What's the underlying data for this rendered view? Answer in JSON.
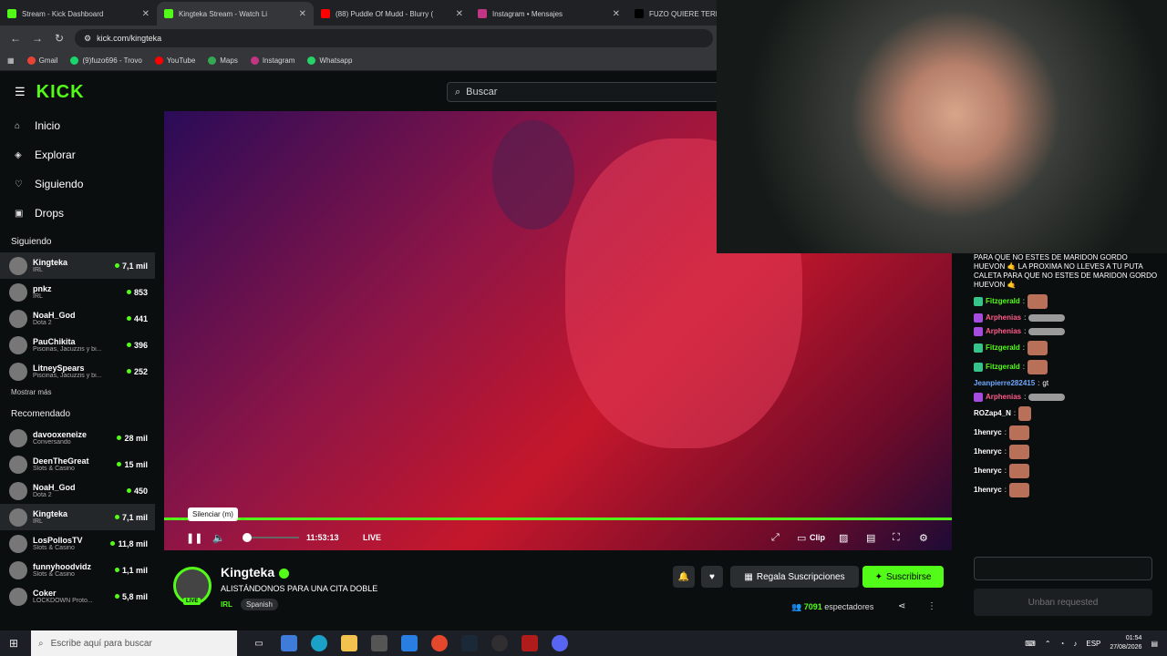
{
  "browser": {
    "tabs": [
      {
        "label": "Stream - Kick Dashboard",
        "color": "#53fc18"
      },
      {
        "label": "Kingteka Stream - Watch Li",
        "color": "#53fc18",
        "active": true
      },
      {
        "label": "(88) Puddle Of Mudd - Blurry (",
        "color": "#ff0000"
      },
      {
        "label": "Instagram • Mensajes",
        "color": "#c13584"
      },
      {
        "label": "FUZO QUIERE TERMINARLE A",
        "color": "#000000"
      }
    ],
    "url": "kick.com/kingteka",
    "bookmarks": [
      "Gmail",
      "(9)fuzo696 - Trovo",
      "YouTube",
      "Maps",
      "Instagram",
      "Whatsapp"
    ]
  },
  "header": {
    "logo": "KICK",
    "search_placeholder": "Buscar"
  },
  "sidebar": {
    "nav": [
      {
        "label": "Inicio",
        "icon": "home-icon"
      },
      {
        "label": "Explorar",
        "icon": "compass-icon"
      },
      {
        "label": "Siguiendo",
        "icon": "heart-icon"
      },
      {
        "label": "Drops",
        "icon": "gift-icon"
      }
    ],
    "following_title": "Siguiendo",
    "following": [
      {
        "name": "Kingteka",
        "category": "IRL",
        "viewers": "7,1 mil",
        "selected": true
      },
      {
        "name": "pnkz",
        "category": "IRL",
        "viewers": "853"
      },
      {
        "name": "NoaH_God",
        "category": "Dota 2",
        "viewers": "441"
      },
      {
        "name": "PauChikita",
        "category": "Piscinas, Jacuzzis y bi...",
        "viewers": "396"
      },
      {
        "name": "LitneySpears",
        "category": "Piscinas, Jacuzzis y bi...",
        "viewers": "252"
      }
    ],
    "show_more": "Mostrar más",
    "recommended_title": "Recomendado",
    "recommended": [
      {
        "name": "davooxeneize",
        "category": "Conversando",
        "viewers": "28 mil"
      },
      {
        "name": "DeenTheGreat",
        "category": "Slots & Casino",
        "viewers": "15 mil"
      },
      {
        "name": "NoaH_God",
        "category": "Dota 2",
        "viewers": "450"
      },
      {
        "name": "Kingteka",
        "category": "IRL",
        "viewers": "7,1 mil",
        "selected": true
      },
      {
        "name": "LosPollosTV",
        "category": "Slots & Casino",
        "viewers": "11,8 mil"
      },
      {
        "name": "funnyhoodvidz",
        "category": "Slots & Casino",
        "viewers": "1,1 mil"
      },
      {
        "name": "Coker",
        "category": "LOCKDOWN Proto...",
        "viewers": "5,8 mil"
      }
    ]
  },
  "player": {
    "tooltip": "Silenciar (m)",
    "time": "11:53:13",
    "live": "LIVE",
    "clip": "Clip"
  },
  "stream": {
    "name": "Kingteka",
    "title": "ALISTÁNDONOS PARA UNA CITA DOBLE",
    "category": "IRL",
    "language": "Spanish",
    "live_tag": "LIVE",
    "gift_button": "Regala Suscripciones",
    "subscribe_button": "Suscribirse",
    "viewers_count": "7091",
    "viewers_label": "espectadores"
  },
  "chat": {
    "messages": [
      {
        "user": "",
        "text": "PARA QUE NO ESTES DE MARIDON GORDO HUEVON 🤙 LA PROXIMA NO LLEVES A TU PUTA CALETA PARA QUE NO ESTES DE MARIDON GORDO HUEVON 🤙"
      },
      {
        "user": "Fitzgerald",
        "text": "",
        "color": "#53fc18"
      },
      {
        "user": "Arphenias",
        "text": "",
        "color": "#ff5b8a"
      },
      {
        "user": "Arphenias",
        "text": "",
        "color": "#ff5b8a"
      },
      {
        "user": "Fitzgerald",
        "text": "",
        "color": "#53fc18"
      },
      {
        "user": "Fitzgerald",
        "text": "",
        "color": "#53fc18"
      },
      {
        "user": "Jeanpierre282415",
        "text": "gt",
        "color": "#6fa8ff"
      },
      {
        "user": "Arphenias",
        "text": "",
        "color": "#ff5b8a"
      },
      {
        "user": "ROZap4_N",
        "text": "",
        "color": "#ffffff"
      },
      {
        "user": "1henryc",
        "text": "",
        "color": "#ffffff"
      },
      {
        "user": "1henryc",
        "text": "",
        "color": "#ffffff"
      },
      {
        "user": "1henryc",
        "text": "",
        "color": "#ffffff"
      },
      {
        "user": "1henryc",
        "text": "",
        "color": "#ffffff"
      }
    ],
    "unban": "Unban requested"
  },
  "taskbar": {
    "search_placeholder": "Escribe aquí para buscar",
    "lang": "ESP",
    "time": "01:54",
    "date": "27/08/2026"
  }
}
